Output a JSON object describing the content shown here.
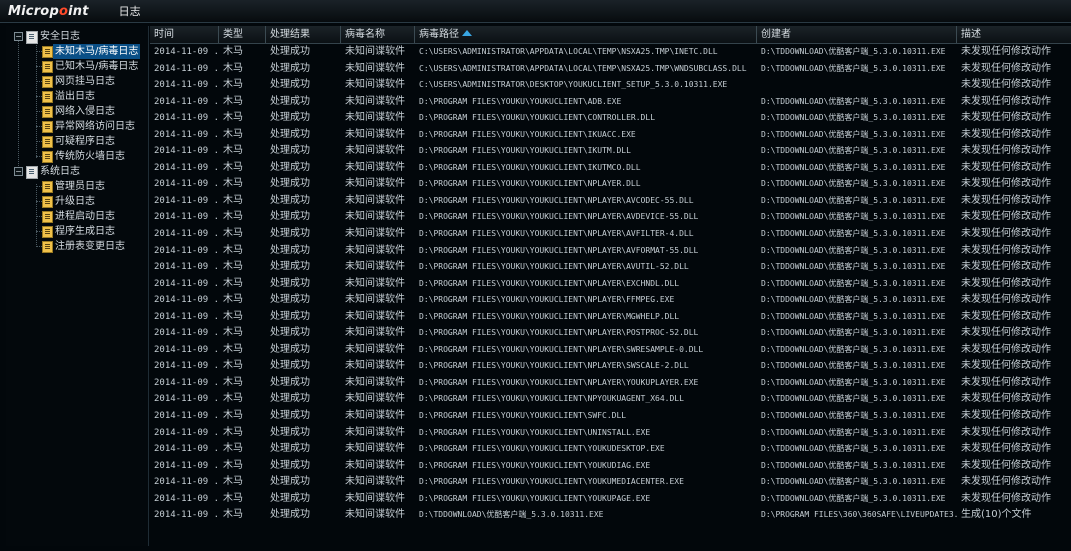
{
  "app": {
    "logo_text_a": "Microp",
    "logo_text_o": "o",
    "logo_text_b": "int",
    "menu_log": "日志"
  },
  "sidebar": {
    "groups": [
      {
        "label": "安全日志",
        "items": [
          "未知木马/病毒日志",
          "已知木马/病毒日志",
          "网页挂马日志",
          "溢出日志",
          "网络入侵日志",
          "异常网络访问日志",
          "可疑程序日志",
          "传统防火墙日志"
        ]
      },
      {
        "label": "系统日志",
        "items": [
          "管理员日志",
          "升级日志",
          "进程启动日志",
          "程序生成日志",
          "注册表变更日志"
        ]
      }
    ],
    "expander_symbol": "−"
  },
  "table": {
    "columns": [
      "时间",
      "类型",
      "处理结果",
      "病毒名称",
      "病毒路径",
      "创建者",
      "描述"
    ],
    "sorted_column": "病毒路径",
    "rows": [
      [
        "2014-11-09 ...",
        "木马",
        "处理成功",
        "未知间谍软件",
        "C:\\USERS\\ADMINISTRATOR\\APPDATA\\LOCAL\\TEMP\\NSXA25.TMP\\INETC.DLL",
        "D:\\TDDOWNLOAD\\优酷客户端_5.3.0.10311.EXE",
        "未发现任何修改动作"
      ],
      [
        "2014-11-09 ...",
        "木马",
        "处理成功",
        "未知间谍软件",
        "C:\\USERS\\ADMINISTRATOR\\APPDATA\\LOCAL\\TEMP\\NSXA25.TMP\\WNDSUBCLASS.DLL",
        "D:\\TDDOWNLOAD\\优酷客户端_5.3.0.10311.EXE",
        "未发现任何修改动作"
      ],
      [
        "2014-11-09 ...",
        "木马",
        "处理成功",
        "未知间谍软件",
        "C:\\USERS\\ADMINISTRATOR\\DESKTOP\\YOUKUCLIENT_SETUP_5.3.0.10311.EXE",
        "",
        "未发现任何修改动作"
      ],
      [
        "2014-11-09 ...",
        "木马",
        "处理成功",
        "未知间谍软件",
        "D:\\PROGRAM FILES\\YOUKU\\YOUKUCLIENT\\ADB.EXE",
        "D:\\TDDOWNLOAD\\优酷客户端_5.3.0.10311.EXE",
        "未发现任何修改动作"
      ],
      [
        "2014-11-09 ...",
        "木马",
        "处理成功",
        "未知间谍软件",
        "D:\\PROGRAM FILES\\YOUKU\\YOUKUCLIENT\\CONTROLLER.DLL",
        "D:\\TDDOWNLOAD\\优酷客户端_5.3.0.10311.EXE",
        "未发现任何修改动作"
      ],
      [
        "2014-11-09 ...",
        "木马",
        "处理成功",
        "未知间谍软件",
        "D:\\PROGRAM FILES\\YOUKU\\YOUKUCLIENT\\IKUACC.EXE",
        "D:\\TDDOWNLOAD\\优酷客户端_5.3.0.10311.EXE",
        "未发现任何修改动作"
      ],
      [
        "2014-11-09 ...",
        "木马",
        "处理成功",
        "未知间谍软件",
        "D:\\PROGRAM FILES\\YOUKU\\YOUKUCLIENT\\IKUTM.DLL",
        "D:\\TDDOWNLOAD\\优酷客户端_5.3.0.10311.EXE",
        "未发现任何修改动作"
      ],
      [
        "2014-11-09 ...",
        "木马",
        "处理成功",
        "未知间谍软件",
        "D:\\PROGRAM FILES\\YOUKU\\YOUKUCLIENT\\IKUTMCO.DLL",
        "D:\\TDDOWNLOAD\\优酷客户端_5.3.0.10311.EXE",
        "未发现任何修改动作"
      ],
      [
        "2014-11-09 ...",
        "木马",
        "处理成功",
        "未知间谍软件",
        "D:\\PROGRAM FILES\\YOUKU\\YOUKUCLIENT\\NPLAYER.DLL",
        "D:\\TDDOWNLOAD\\优酷客户端_5.3.0.10311.EXE",
        "未发现任何修改动作"
      ],
      [
        "2014-11-09 ...",
        "木马",
        "处理成功",
        "未知间谍软件",
        "D:\\PROGRAM FILES\\YOUKU\\YOUKUCLIENT\\NPLAYER\\AVCODEC-55.DLL",
        "D:\\TDDOWNLOAD\\优酷客户端_5.3.0.10311.EXE",
        "未发现任何修改动作"
      ],
      [
        "2014-11-09 ...",
        "木马",
        "处理成功",
        "未知间谍软件",
        "D:\\PROGRAM FILES\\YOUKU\\YOUKUCLIENT\\NPLAYER\\AVDEVICE-55.DLL",
        "D:\\TDDOWNLOAD\\优酷客户端_5.3.0.10311.EXE",
        "未发现任何修改动作"
      ],
      [
        "2014-11-09 ...",
        "木马",
        "处理成功",
        "未知间谍软件",
        "D:\\PROGRAM FILES\\YOUKU\\YOUKUCLIENT\\NPLAYER\\AVFILTER-4.DLL",
        "D:\\TDDOWNLOAD\\优酷客户端_5.3.0.10311.EXE",
        "未发现任何修改动作"
      ],
      [
        "2014-11-09 ...",
        "木马",
        "处理成功",
        "未知间谍软件",
        "D:\\PROGRAM FILES\\YOUKU\\YOUKUCLIENT\\NPLAYER\\AVFORMAT-55.DLL",
        "D:\\TDDOWNLOAD\\优酷客户端_5.3.0.10311.EXE",
        "未发现任何修改动作"
      ],
      [
        "2014-11-09 ...",
        "木马",
        "处理成功",
        "未知间谍软件",
        "D:\\PROGRAM FILES\\YOUKU\\YOUKUCLIENT\\NPLAYER\\AVUTIL-52.DLL",
        "D:\\TDDOWNLOAD\\优酷客户端_5.3.0.10311.EXE",
        "未发现任何修改动作"
      ],
      [
        "2014-11-09 ...",
        "木马",
        "处理成功",
        "未知间谍软件",
        "D:\\PROGRAM FILES\\YOUKU\\YOUKUCLIENT\\NPLAYER\\EXCHNDL.DLL",
        "D:\\TDDOWNLOAD\\优酷客户端_5.3.0.10311.EXE",
        "未发现任何修改动作"
      ],
      [
        "2014-11-09 ...",
        "木马",
        "处理成功",
        "未知间谍软件",
        "D:\\PROGRAM FILES\\YOUKU\\YOUKUCLIENT\\NPLAYER\\FFMPEG.EXE",
        "D:\\TDDOWNLOAD\\优酷客户端_5.3.0.10311.EXE",
        "未发现任何修改动作"
      ],
      [
        "2014-11-09 ...",
        "木马",
        "处理成功",
        "未知间谍软件",
        "D:\\PROGRAM FILES\\YOUKU\\YOUKUCLIENT\\NPLAYER\\MGWHELP.DLL",
        "D:\\TDDOWNLOAD\\优酷客户端_5.3.0.10311.EXE",
        "未发现任何修改动作"
      ],
      [
        "2014-11-09 ...",
        "木马",
        "处理成功",
        "未知间谍软件",
        "D:\\PROGRAM FILES\\YOUKU\\YOUKUCLIENT\\NPLAYER\\POSTPROC-52.DLL",
        "D:\\TDDOWNLOAD\\优酷客户端_5.3.0.10311.EXE",
        "未发现任何修改动作"
      ],
      [
        "2014-11-09 ...",
        "木马",
        "处理成功",
        "未知间谍软件",
        "D:\\PROGRAM FILES\\YOUKU\\YOUKUCLIENT\\NPLAYER\\SWRESAMPLE-0.DLL",
        "D:\\TDDOWNLOAD\\优酷客户端_5.3.0.10311.EXE",
        "未发现任何修改动作"
      ],
      [
        "2014-11-09 ...",
        "木马",
        "处理成功",
        "未知间谍软件",
        "D:\\PROGRAM FILES\\YOUKU\\YOUKUCLIENT\\NPLAYER\\SWSCALE-2.DLL",
        "D:\\TDDOWNLOAD\\优酷客户端_5.3.0.10311.EXE",
        "未发现任何修改动作"
      ],
      [
        "2014-11-09 ...",
        "木马",
        "处理成功",
        "未知间谍软件",
        "D:\\PROGRAM FILES\\YOUKU\\YOUKUCLIENT\\NPLAYER\\YOUKUPLAYER.EXE",
        "D:\\TDDOWNLOAD\\优酷客户端_5.3.0.10311.EXE",
        "未发现任何修改动作"
      ],
      [
        "2014-11-09 ...",
        "木马",
        "处理成功",
        "未知间谍软件",
        "D:\\PROGRAM FILES\\YOUKU\\YOUKUCLIENT\\NPYOUKUAGENT_X64.DLL",
        "D:\\TDDOWNLOAD\\优酷客户端_5.3.0.10311.EXE",
        "未发现任何修改动作"
      ],
      [
        "2014-11-09 ...",
        "木马",
        "处理成功",
        "未知间谍软件",
        "D:\\PROGRAM FILES\\YOUKU\\YOUKUCLIENT\\SWFC.DLL",
        "D:\\TDDOWNLOAD\\优酷客户端_5.3.0.10311.EXE",
        "未发现任何修改动作"
      ],
      [
        "2014-11-09 ...",
        "木马",
        "处理成功",
        "未知间谍软件",
        "D:\\PROGRAM FILES\\YOUKU\\YOUKUCLIENT\\UNINSTALL.EXE",
        "D:\\TDDOWNLOAD\\优酷客户端_5.3.0.10311.EXE",
        "未发现任何修改动作"
      ],
      [
        "2014-11-09 ...",
        "木马",
        "处理成功",
        "未知间谍软件",
        "D:\\PROGRAM FILES\\YOUKU\\YOUKUCLIENT\\YOUKUDESKTOP.EXE",
        "D:\\TDDOWNLOAD\\优酷客户端_5.3.0.10311.EXE",
        "未发现任何修改动作"
      ],
      [
        "2014-11-09 ...",
        "木马",
        "处理成功",
        "未知间谍软件",
        "D:\\PROGRAM FILES\\YOUKU\\YOUKUCLIENT\\YOUKUDIAG.EXE",
        "D:\\TDDOWNLOAD\\优酷客户端_5.3.0.10311.EXE",
        "未发现任何修改动作"
      ],
      [
        "2014-11-09 ...",
        "木马",
        "处理成功",
        "未知间谍软件",
        "D:\\PROGRAM FILES\\YOUKU\\YOUKUCLIENT\\YOUKUMEDIACENTER.EXE",
        "D:\\TDDOWNLOAD\\优酷客户端_5.3.0.10311.EXE",
        "未发现任何修改动作"
      ],
      [
        "2014-11-09 ...",
        "木马",
        "处理成功",
        "未知间谍软件",
        "D:\\PROGRAM FILES\\YOUKU\\YOUKUCLIENT\\YOUKUPAGE.EXE",
        "D:\\TDDOWNLOAD\\优酷客户端_5.3.0.10311.EXE",
        "未发现任何修改动作"
      ],
      [
        "2014-11-09 ...",
        "木马",
        "处理成功",
        "未知间谍软件",
        "D:\\TDDOWNLOAD\\优酷客户端_5.3.0.10311.EXE",
        "D:\\PROGRAM FILES\\360\\360SAFE\\LIVEUPDATE3...",
        "生成(10)个文件"
      ]
    ]
  }
}
